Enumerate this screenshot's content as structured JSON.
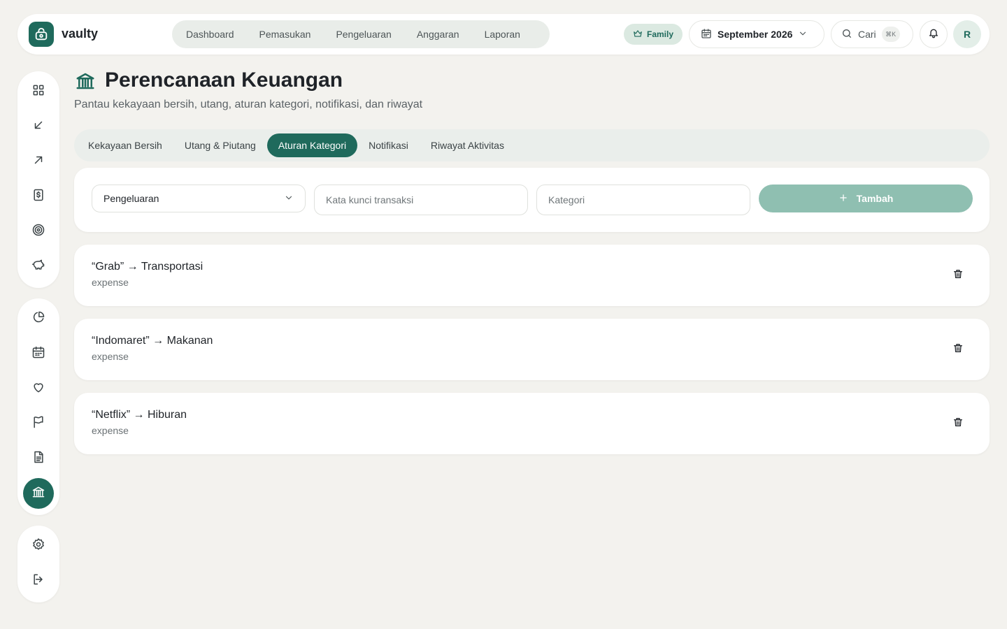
{
  "app": {
    "name": "vaulty"
  },
  "nav": {
    "items": [
      {
        "label": "Dashboard"
      },
      {
        "label": "Pemasukan"
      },
      {
        "label": "Pengeluaran"
      },
      {
        "label": "Anggaran"
      },
      {
        "label": "Laporan"
      }
    ]
  },
  "header": {
    "plan_badge": "Family",
    "month": "September 2026",
    "search_label": "Cari",
    "search_shortcut": "⌘K",
    "avatar_initial": "R"
  },
  "sidebar": {
    "groups": [
      {
        "items": [
          "grid-icon",
          "arrow-down-left-icon",
          "arrow-up-right-icon",
          "dollar-receipt-icon",
          "target-icon",
          "piggy-bank-icon"
        ]
      },
      {
        "items": [
          "pie-chart-icon",
          "calendar-icon",
          "heart-icon",
          "flag-icon",
          "document-icon",
          "bank-icon"
        ],
        "active": "bank-icon"
      },
      {
        "items": [
          "settings-icon",
          "logout-icon"
        ]
      }
    ]
  },
  "page": {
    "title": "Perencanaan Keuangan",
    "subtitle": "Pantau kekayaan bersih, utang, aturan kategori, notifikasi, dan riwayat"
  },
  "tabs": [
    {
      "label": "Kekayaan Bersih",
      "active": false
    },
    {
      "label": "Utang & Piutang",
      "active": false
    },
    {
      "label": "Aturan Kategori",
      "active": true
    },
    {
      "label": "Notifikasi",
      "active": false
    },
    {
      "label": "Riwayat Aktivitas",
      "active": false
    }
  ],
  "form": {
    "type_value": "Pengeluaran",
    "keyword_placeholder": "Kata kunci transaksi",
    "category_placeholder": "Kategori",
    "add_label": "Tambah"
  },
  "rules": [
    {
      "title": "“Grab” → Transportasi",
      "type": "expense"
    },
    {
      "title": "“Indomaret” → Makanan",
      "type": "expense"
    },
    {
      "title": "“Netflix” → Hiburan",
      "type": "expense"
    }
  ],
  "colors": {
    "accent": "#1f6a5c",
    "accent_light": "#8fbfb1",
    "background": "#f3f2ee"
  }
}
